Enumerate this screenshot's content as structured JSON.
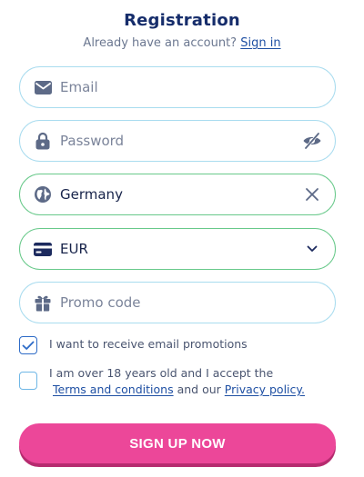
{
  "header": {
    "title": "Registration",
    "subtitle": "Already have an account?",
    "signin_link": "Sign in"
  },
  "fields": {
    "email": {
      "placeholder": "Email",
      "icon": "envelope-icon"
    },
    "password": {
      "placeholder": "Password",
      "icon": "lock-icon",
      "toggle_icon": "eye-slash-icon"
    },
    "country": {
      "value": "Germany",
      "icon": "globe-icon",
      "clear_icon": "close-icon"
    },
    "currency": {
      "value": "EUR",
      "icon": "card-icon",
      "dropdown_icon": "chevron-down-icon"
    },
    "promo": {
      "placeholder": "Promo code",
      "icon": "gift-icon"
    }
  },
  "consents": {
    "promotions": {
      "label": "I want to receive email promotions",
      "checked": true
    },
    "terms": {
      "label_prefix": "I am over 18 years old and I accept the",
      "terms_link": "Terms and conditions",
      "middle": "and our",
      "privacy_link": "Privacy policy.",
      "checked": false
    }
  },
  "submit_label": "SIGN UP NOW",
  "colors": {
    "title": "#162d6b",
    "field_border": "#a9dcef",
    "field_valid_border": "#68c98a",
    "icon": "#5d6a87",
    "link": "#1e4fa3",
    "button": "#ec4799",
    "button_shadow": "#b62b6f"
  }
}
